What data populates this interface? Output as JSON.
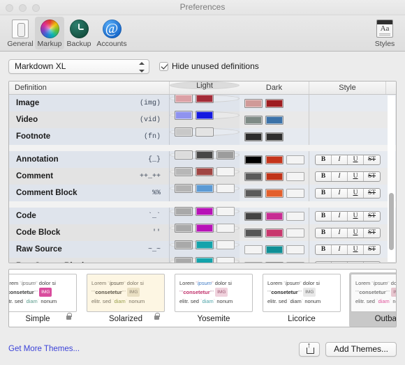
{
  "window": {
    "title": "Preferences"
  },
  "toolbar": {
    "items": [
      {
        "label": "General",
        "icon": "document-icon",
        "selected": false
      },
      {
        "label": "Markup",
        "icon": "color-wheel-icon",
        "selected": true
      },
      {
        "label": "Backup",
        "icon": "clock-icon",
        "selected": false
      },
      {
        "label": "Accounts",
        "icon": "at-sign-icon",
        "selected": false
      }
    ],
    "trailing": {
      "label": "Styles",
      "icon": "text-styles-icon"
    }
  },
  "controls": {
    "theme_popup_value": "Markdown XL",
    "hide_unused_label": "Hide unused definitions",
    "hide_unused_checked": true
  },
  "table": {
    "headers": [
      "Definition",
      "Light",
      "Dark",
      "Style"
    ],
    "style_buttons": [
      "B",
      "I",
      "U",
      "ST"
    ],
    "rows": [
      {
        "name": "Image",
        "marker": "(img)",
        "light": [
          "#dba0a5",
          "#a32c38",
          null
        ],
        "dark": [
          "#d09a98",
          "#9e1d21",
          null
        ],
        "style": false,
        "group": 1
      },
      {
        "name": "Video",
        "marker": "(vid)",
        "light": [
          "#8f93ef",
          "#1419e0",
          null
        ],
        "dark": [
          "#7e8a85",
          "#3b72a8",
          null
        ],
        "style": false,
        "group": 1
      },
      {
        "name": "Footnote",
        "marker": "(fn)",
        "light": [
          "#c8c8c8",
          "#e3e3e3",
          null
        ],
        "dark": [
          "#2c2c2c",
          "#2e2e2e",
          null
        ],
        "style": false,
        "group": 1
      },
      {
        "name": "Annotation",
        "marker": "{_}",
        "light": [
          "#dcdcdc",
          "#464646",
          "#9c9c9c"
        ],
        "dark": [
          "#000000",
          "#c4341b",
          "empty"
        ],
        "style": true,
        "group": 2
      },
      {
        "name": "Comment",
        "marker": "++_++",
        "light": [
          "#b7b7b7",
          "#a04542",
          "empty"
        ],
        "dark": [
          "#5a5a5a",
          "#c03318",
          "empty"
        ],
        "style": true,
        "group": 2
      },
      {
        "name": "Comment Block",
        "marker": "%%",
        "light": [
          "#b3b3b3",
          "#5b9ad4",
          "empty"
        ],
        "dark": [
          "#5a5a5a",
          "#e35f2c",
          "empty"
        ],
        "style": true,
        "group": 2
      },
      {
        "name": "Code",
        "marker": "`_`",
        "light": [
          "#a9a9a9",
          "#b711b7",
          "empty"
        ],
        "dark": [
          "#434343",
          "#c72c93",
          "empty"
        ],
        "style": true,
        "group": 3
      },
      {
        "name": "Code Block",
        "marker": "''",
        "light": [
          "#a9a9a9",
          "#b711b7",
          "empty"
        ],
        "dark": [
          "#555555",
          "#c8376c",
          "empty"
        ],
        "style": true,
        "group": 3
      },
      {
        "name": "Raw Source",
        "marker": "~_~",
        "light": [
          "#a9a9a9",
          "#13a3ab",
          "empty"
        ],
        "dark": [
          "empty",
          "#0f8f96",
          "empty"
        ],
        "style": true,
        "group": 3
      },
      {
        "name": "Raw Source Block",
        "marker": "~~",
        "light": [
          "#a9a9a9",
          "#13a3ab",
          "empty"
        ],
        "dark": [
          "empty",
          "#0f8f96",
          "empty"
        ],
        "style": true,
        "group": 3
      }
    ]
  },
  "themes": {
    "items": [
      {
        "name": "Simple",
        "locked": true,
        "selected": false,
        "bg": "#ffffff",
        "text": "#3d3d3d",
        "line1_pre": "Lorem ",
        "line1_mark": "\"",
        "line1_em": "ipsum",
        "line1_post": " dolor si",
        "em_color": "#6b6b6b",
        "line2_strong": "consetetur",
        "strong_color": "#3d3d3d",
        "img_label": "IMG",
        "img_bg": "#d94d9e",
        "img_fg": "#ffffff",
        "line3_pre": "elitr. sed ",
        "line3_code": "diam",
        "code_color": "#5a9c8c",
        "line3_post": " nonum",
        "marker_color": "#c2c2c2"
      },
      {
        "name": "Solarized",
        "locked": true,
        "selected": false,
        "bg": "#fdf6e3",
        "text": "#7d7564",
        "line1_pre": "Lorem ",
        "line1_mark": "\"",
        "line1_em": "ipsum",
        "line1_post": " dolor si",
        "em_color": "#5c5547",
        "line2_strong": "consetetur",
        "strong_color": "#5c5547",
        "img_label": "IMG",
        "img_bg": "#e9dfc2",
        "img_fg": "#8a8070",
        "line3_pre": "elitr. sed ",
        "line3_code": "diam",
        "code_color": "#9aa04d",
        "line3_post": " nonum",
        "marker_color": "#cfc6ad"
      },
      {
        "name": "Yosemite",
        "locked": false,
        "selected": false,
        "bg": "#ffffff",
        "text": "#3d3d3d",
        "line1_pre": "Lorem ",
        "line1_mark": "\"",
        "line1_em": "ipsum",
        "line1_post": " dolor si",
        "em_color": "#3b78c4",
        "line2_strong": "consetetur",
        "strong_color": "#c0306a",
        "img_label": "IMG",
        "img_bg": "#f0d2dd",
        "img_fg": "#9b5570",
        "line3_pre": "elitr. sed ",
        "line3_code": "diam",
        "code_color": "#4da3a8",
        "line3_post": " nonum",
        "marker_color": "#c9a0b4"
      },
      {
        "name": "Licorice",
        "locked": false,
        "selected": false,
        "bg": "#ffffff",
        "text": "#3d3d3d",
        "line1_pre": "Lorem ",
        "line1_mark": "\"",
        "line1_em": "ipsum",
        "line1_post": " dolor si",
        "em_color": "#3d3d3d",
        "line2_strong": "consetetur",
        "strong_color": "#2a2a2a",
        "img_label": "IMG",
        "img_bg": "#e8e8e8",
        "img_fg": "#6a6a6a",
        "line3_pre": "elitr. sed ",
        "line3_code": "diam",
        "code_color": "#3d3d3d",
        "line3_post": " nonum",
        "marker_color": "#b5b5b5"
      },
      {
        "name": "Outback",
        "locked": false,
        "selected": true,
        "bg": "#fafafa",
        "text": "#5c5c5c",
        "line1_pre": "Lorem ",
        "line1_mark": "\"",
        "line1_em": "ipsum",
        "line1_post": " dolor si",
        "em_color": "#5c5c5c",
        "line2_strong": "consetetur",
        "strong_color": "#7a7a7a",
        "img_label": "IMG",
        "img_bg": "#e7c6cf",
        "img_fg": "#9a6f7d",
        "line3_pre": "elitr. sed ",
        "line3_code": "diam",
        "code_color": "#e0519a",
        "line3_post": " nonum",
        "marker_color": "#c4c4c4"
      }
    ]
  },
  "footer": {
    "get_more_label": "Get More Themes...",
    "share_icon": "share-icon",
    "add_themes_label": "Add Themes..."
  }
}
